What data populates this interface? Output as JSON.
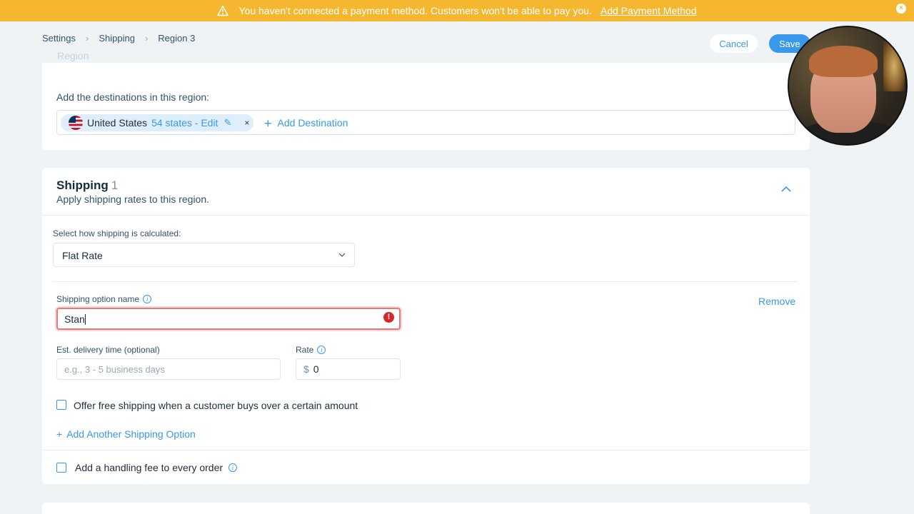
{
  "banner": {
    "message": "You haven't connected a payment method. Customers won't be able to pay you.",
    "link": "Add Payment Method",
    "close": "×",
    "color": "#f5b730"
  },
  "breadcrumb": [
    "Settings",
    "Shipping",
    "Region 3"
  ],
  "header": {
    "faded_section_title": "Region",
    "cancel_label": "Cancel",
    "save_label": "Save"
  },
  "destinations": {
    "label": "Add the destinations in this region:",
    "chip": {
      "country": "United States",
      "states": "54 states - Edit",
      "remove": "×"
    },
    "add_label": "Add Destination"
  },
  "shipping": {
    "title": "Shipping",
    "count": "1",
    "subtitle": "Apply shipping rates to this region.",
    "calc_label": "Select how shipping is calculated:",
    "calc_value": "Flat Rate",
    "option_name_label": "Shipping option name",
    "option_name_value": "Stan",
    "remove_label": "Remove",
    "error_icon": "!",
    "est_label": "Est. delivery time (optional)",
    "est_placeholder": "e.g., 3 - 5 business days",
    "rate_label": "Rate",
    "rate_currency": "$",
    "rate_value": "0",
    "free_shipping_label": "Offer free shipping when a customer buys over a certain amount",
    "add_option_label": "Add Another Shipping Option",
    "handling_label": "Add a handling fee to every order"
  },
  "colors": {
    "accent": "#3899ec",
    "error": "#d6262c"
  }
}
